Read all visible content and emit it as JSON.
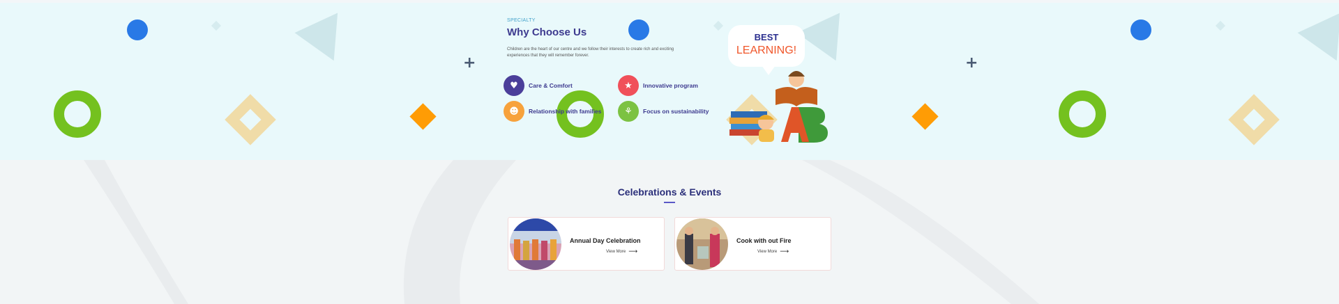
{
  "specialty": {
    "eyebrow": "SPECIALTY",
    "heading": "Why Choose Us",
    "description": "Children are the heart of our centre and we follow their interests to create rich and exciting experiences that they will remember forever.",
    "features": [
      {
        "label": "Care & Comfort",
        "icon": "care-icon",
        "color": "#4b3f9a"
      },
      {
        "label": "Innovative program",
        "icon": "innovation-icon",
        "color": "#f0505a"
      },
      {
        "label": "Relationship with families",
        "icon": "family-icon",
        "color": "#f7a23c"
      },
      {
        "label": "Focus on sustainability",
        "icon": "sustainability-icon",
        "color": "#7cc242"
      }
    ],
    "illustration": {
      "bubble_line1": "BEST",
      "bubble_line2": "LEARNING!"
    }
  },
  "events": {
    "title": "Celebrations & Events",
    "cards": [
      {
        "title": "Annual Day Celebration",
        "more": "View More"
      },
      {
        "title": "Cook with out Fire",
        "more": "View More"
      }
    ]
  },
  "colors": {
    "accent": "#3d3a8f",
    "top_bg": "#e9f9fb",
    "blue_dot": "#2979e6",
    "green_ring": "#74c11f",
    "orange": "#ff9c05"
  }
}
